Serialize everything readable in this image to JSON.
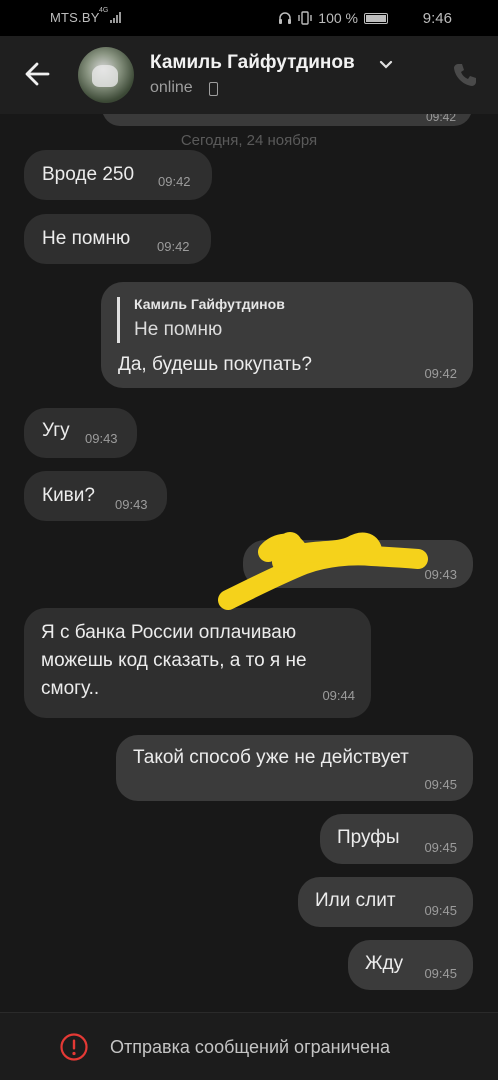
{
  "status_bar": {
    "carrier": "MTS.BY",
    "network": "4G",
    "battery": "100 %",
    "time": "9:46"
  },
  "header": {
    "contact_name": "Камиль Гайфутдинов",
    "status": "online"
  },
  "chat": {
    "clipped_time": "09:42",
    "date_separator": "Сегодня, 24 ноября",
    "messages": [
      {
        "dir": "in",
        "text": "Вроде 250",
        "time": "09:42"
      },
      {
        "dir": "in",
        "text": "Не помню",
        "time": "09:42"
      },
      {
        "dir": "out",
        "quote_author": "Камиль Гайфутдинов",
        "quote_text": "Не помню",
        "text": "Да, будешь покупать?",
        "time": "09:42"
      },
      {
        "dir": "in",
        "text": "Угу",
        "time": "09:43"
      },
      {
        "dir": "in",
        "text": "Киви?",
        "time": "09:43"
      },
      {
        "dir": "out",
        "text": "",
        "time": "09:43"
      },
      {
        "dir": "in",
        "lines": [
          "Я с банка России оплачиваю",
          "можешь код сказать, а то я не",
          "смогу.."
        ],
        "time": "09:44"
      },
      {
        "dir": "out",
        "text": "Такой способ уже не действует",
        "time": "09:45"
      },
      {
        "dir": "out",
        "text": "Пруфы",
        "time": "09:45"
      },
      {
        "dir": "out",
        "text": "Или слит",
        "time": "09:45"
      },
      {
        "dir": "out",
        "text": "Жду",
        "time": "09:45"
      }
    ]
  },
  "bottom": {
    "restriction_text": "Отправка сообщений ограничена"
  },
  "colors": {
    "background": "#181818",
    "bubble_in": "#2f2f2f",
    "bubble_out": "#3b3b3b",
    "warning_red": "#e53935",
    "redaction_yellow": "#f5d21b"
  }
}
